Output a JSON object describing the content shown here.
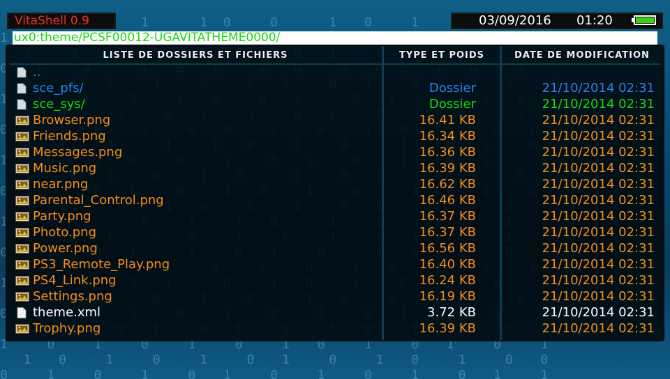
{
  "app": {
    "title": "VitaShell 0.9"
  },
  "status": {
    "date": "03/09/2016",
    "time": "01:20",
    "battery_level": 1.0,
    "battery_color": "#3cd01a"
  },
  "path": "ux0:theme/PCSF00012-UGAVITATHEME0000/",
  "columns": {
    "name": "LISTE DE DOSSIERS ET FICHIERS",
    "type_size": "TYPE ET POIDS",
    "date": "DATE DE MODIFICATION"
  },
  "colors": {
    "folder": "#2d7fe8",
    "system_folder": "#19d80f",
    "image": "#f58c1a",
    "text": "#ffffff",
    "title": "#e8322a"
  },
  "files": [
    {
      "icon": "folder-icon",
      "name": "..",
      "type": "",
      "date": "",
      "color": "blue"
    },
    {
      "icon": "folder-icon",
      "name": "sce_pfs/",
      "type": "Dossier",
      "date": "21/10/2014 02:31",
      "color": "blue"
    },
    {
      "icon": "folder-icon",
      "name": "sce_sys/",
      "type": "Dossier",
      "date": "21/10/2014 02:31",
      "color": "green"
    },
    {
      "icon": "image-file-icon",
      "name": "Browser.png",
      "type": "16.41 KB",
      "date": "21/10/2014 02:31",
      "color": "orange"
    },
    {
      "icon": "image-file-icon",
      "name": "Friends.png",
      "type": "16.34 KB",
      "date": "21/10/2014 02:31",
      "color": "orange"
    },
    {
      "icon": "image-file-icon",
      "name": "Messages.png",
      "type": "16.36 KB",
      "date": "21/10/2014 02:31",
      "color": "orange"
    },
    {
      "icon": "image-file-icon",
      "name": "Music.png",
      "type": "16.39 KB",
      "date": "21/10/2014 02:31",
      "color": "orange"
    },
    {
      "icon": "image-file-icon",
      "name": "near.png",
      "type": "16.62 KB",
      "date": "21/10/2014 02:31",
      "color": "orange"
    },
    {
      "icon": "image-file-icon",
      "name": "Parental_Control.png",
      "type": "16.46 KB",
      "date": "21/10/2014 02:31",
      "color": "orange"
    },
    {
      "icon": "image-file-icon",
      "name": "Party.png",
      "type": "16.37 KB",
      "date": "21/10/2014 02:31",
      "color": "orange"
    },
    {
      "icon": "image-file-icon",
      "name": "Photo.png",
      "type": "16.37 KB",
      "date": "21/10/2014 02:31",
      "color": "orange"
    },
    {
      "icon": "image-file-icon",
      "name": "Power.png",
      "type": "16.56 KB",
      "date": "21/10/2014 02:31",
      "color": "orange"
    },
    {
      "icon": "image-file-icon",
      "name": "PS3_Remote_Play.png",
      "type": "16.40 KB",
      "date": "21/10/2014 02:31",
      "color": "orange"
    },
    {
      "icon": "image-file-icon",
      "name": "PS4_Link.png",
      "type": "16.24 KB",
      "date": "21/10/2014 02:31",
      "color": "orange"
    },
    {
      "icon": "image-file-icon",
      "name": "Settings.png",
      "type": "16.19 KB",
      "date": "21/10/2014 02:31",
      "color": "orange"
    },
    {
      "icon": "text-file-icon",
      "name": "theme.xml",
      "type": "3.72 KB",
      "date": "21/10/2014 02:31",
      "color": "white"
    },
    {
      "icon": "image-file-icon",
      "name": "Trophy.png",
      "type": "16.39 KB",
      "date": "21/10/2014 02:31",
      "color": "orange"
    }
  ]
}
